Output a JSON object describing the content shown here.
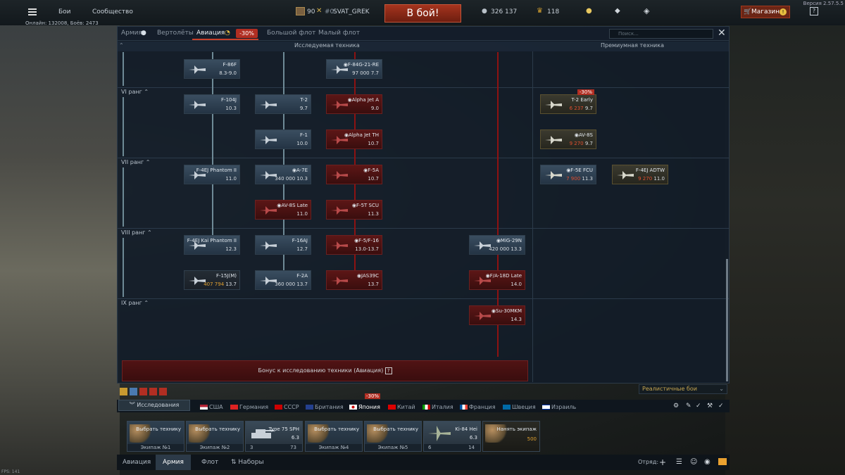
{
  "topbar": {
    "battles": "Бои",
    "community": "Сообщество",
    "level": "90",
    "nick": "SVAT_GREK",
    "to_battle": "В бой!",
    "silver_lions": "326 137",
    "golden_eagles": "118",
    "shop": "Магазин",
    "version": "Версия 2.57.5.5",
    "online": "Онлайн: 132008, Боёв: 2473"
  },
  "tabs": {
    "army": "Армия",
    "helicopters": "Вертолёты",
    "aviation": "Авиация",
    "discount": "-30%",
    "bluewater": "Большой флот",
    "coastal": "Малый флот",
    "search_placeholder": "Поиск..."
  },
  "headers": {
    "research": "Исследуемая техника",
    "premium": "Премиумная техника"
  },
  "ranks": [
    "VI ранг",
    "VII ранг",
    "VIII ранг",
    "IX ранг"
  ],
  "vehicles": {
    "f86f": {
      "name": "F-86F",
      "val": "8.3-9.0"
    },
    "f84g": {
      "name": "F-84G-21-RE",
      "val": "97 000",
      "br": "7.7"
    },
    "f104j": {
      "name": "F-104J",
      "val": "10.3"
    },
    "t2": {
      "name": "T-2",
      "val": "9.7"
    },
    "alphaa": {
      "name": "Alpha Jet A",
      "val": "9.0"
    },
    "t2early": {
      "name": "T-2 Early",
      "val": "6 237",
      "br": "9.7",
      "disc": "-30%"
    },
    "f1": {
      "name": "F-1",
      "val": "10.0"
    },
    "alphath": {
      "name": "Alpha Jet TH",
      "val": "10.7"
    },
    "av8s": {
      "name": "AV-8S",
      "val": "9 270",
      "br": "9.7"
    },
    "f4ej": {
      "name": "F-4EJ Phantom II",
      "val": "11.0"
    },
    "a7e": {
      "name": "A-7E",
      "val": "340 000",
      "br": "10.3"
    },
    "f5a": {
      "name": "F-5A",
      "val": "10.7"
    },
    "f5efcu": {
      "name": "F-5E FCU",
      "val": "7 900",
      "br": "11.3"
    },
    "f4ejadtw": {
      "name": "F-4EJ ADTW",
      "val": "9 270",
      "br": "11.0"
    },
    "av8slate": {
      "name": "AV-8S Late",
      "val": "11.0"
    },
    "f5tscu": {
      "name": "F-5T SCU",
      "val": "11.3"
    },
    "f4ejkai": {
      "name": "F-4EJ Kai Phantom II",
      "val": "12.3"
    },
    "f16aj": {
      "name": "F-16AJ",
      "val": "12.7"
    },
    "f5ff16": {
      "name": "F-5/F-16",
      "val": "13.0-13.7"
    },
    "mig29n": {
      "name": "MiG-29N",
      "val": "420 000",
      "br": "13.3"
    },
    "f15j": {
      "name": "F-15J(M)",
      "val": "407 794",
      "br": "13.7"
    },
    "f2a": {
      "name": "F-2A",
      "val": "360 000",
      "br": "13.7"
    },
    "jas39c": {
      "name": "JAS39C",
      "val": "13.7"
    },
    "fa18d": {
      "name": "F/A-18D Late",
      "val": "14.0"
    },
    "su30": {
      "name": "Su-30MKM",
      "val": "14.3"
    }
  },
  "bonus": "Бонус к исследованию техники (Авиация)",
  "mode": "Реалистичные бои",
  "nations": {
    "research": "Исследования",
    "list": [
      "США",
      "Германия",
      "СССР",
      "Британия",
      "Япония",
      "Китай",
      "Италия",
      "Франция",
      "Швеция",
      "Израиль"
    ],
    "nation_discount": "-30%"
  },
  "crews": [
    {
      "name": "Выбрать технику",
      "foot": "Экипаж №1"
    },
    {
      "name": "Выбрать технику",
      "foot": "Экипаж №2"
    },
    {
      "name": "Type 75 SPH",
      "br": "6.3",
      "num": "3",
      "extra": "73"
    },
    {
      "name": "Выбрать технику",
      "foot": "Экипаж №4"
    },
    {
      "name": "Выбрать технику",
      "foot": "Экипаж №5"
    },
    {
      "name": "Ki-84 Hei",
      "br": "6.3",
      "num": "6",
      "extra": "14"
    },
    {
      "name": "Нанять экипаж",
      "cost": "500"
    }
  ],
  "bottom": {
    "aviation": "Авиация",
    "army": "Армия",
    "fleet": "Флот",
    "squads": "Наборы",
    "squad": "Отряд:",
    "fps": "FPS: 141"
  }
}
